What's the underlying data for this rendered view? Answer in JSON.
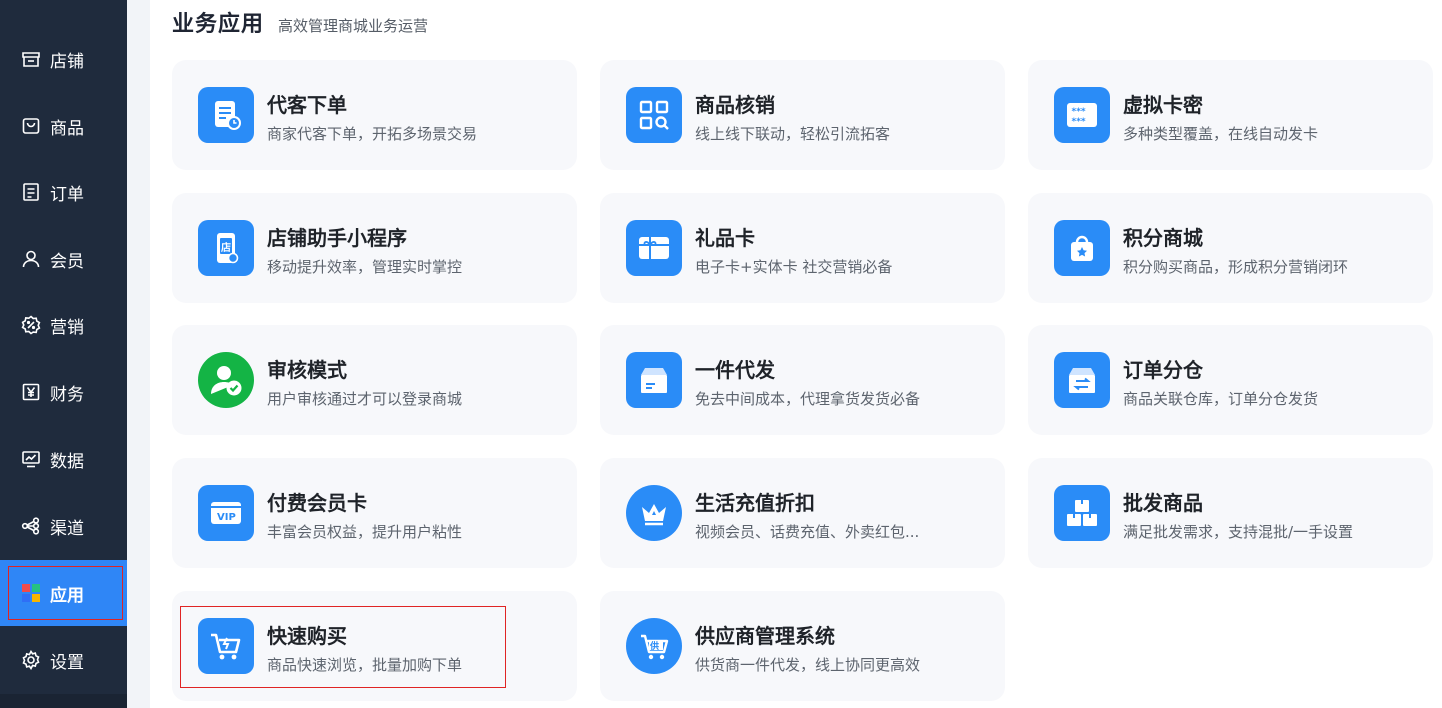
{
  "sidebar": {
    "items": [
      {
        "label": "店铺",
        "icon": "store-icon"
      },
      {
        "label": "商品",
        "icon": "bag-icon"
      },
      {
        "label": "订单",
        "icon": "order-icon"
      },
      {
        "label": "会员",
        "icon": "user-icon"
      },
      {
        "label": "营销",
        "icon": "discount-icon"
      },
      {
        "label": "财务",
        "icon": "yen-icon"
      },
      {
        "label": "数据",
        "icon": "chart-monitor-icon"
      },
      {
        "label": "渠道",
        "icon": "share-icon"
      },
      {
        "label": "应用",
        "icon": "apps-grid-icon",
        "active": true
      },
      {
        "label": "设置",
        "icon": "gear-icon"
      }
    ]
  },
  "section": {
    "title": "业务应用",
    "subtitle": "高效管理商城业务运营"
  },
  "apps": [
    {
      "name": "代客下单",
      "desc": "商家代客下单，开拓多场景交易",
      "icon": "proxy-order-icon"
    },
    {
      "name": "商品核销",
      "desc": "线上线下联动，轻松引流拓客",
      "icon": "qr-verify-icon"
    },
    {
      "name": "虚拟卡密",
      "desc": "多种类型覆盖，在线自动发卡",
      "icon": "password-card-icon"
    },
    {
      "name": "店铺助手小程序",
      "desc": "移动提升效率，管理实时掌控",
      "icon": "phone-store-icon"
    },
    {
      "name": "礼品卡",
      "desc": "电子卡+实体卡 社交营销必备",
      "icon": "gift-card-icon"
    },
    {
      "name": "积分商城",
      "desc": "积分购买商品，形成积分营销闭环",
      "icon": "points-bag-icon"
    },
    {
      "name": "审核模式",
      "desc": "用户审核通过才可以登录商城",
      "icon": "user-check-icon"
    },
    {
      "name": "一件代发",
      "desc": "免去中间成本，代理拿货发货必备",
      "icon": "box-ship-icon"
    },
    {
      "name": "订单分仓",
      "desc": "商品关联仓库，订单分仓发货",
      "icon": "warehouse-icon"
    },
    {
      "name": "付费会员卡",
      "desc": "丰富会员权益，提升用户粘性",
      "icon": "vip-card-icon"
    },
    {
      "name": "生活充值折扣",
      "desc": "视频会员、话费充值、外卖红包...",
      "icon": "crown-icon"
    },
    {
      "name": "批发商品",
      "desc": "满足批发需求，支持混批/一手设置",
      "icon": "boxes-icon"
    },
    {
      "name": "快速购买",
      "desc": "商品快速浏览，批量加购下单",
      "icon": "quick-cart-icon"
    },
    {
      "name": "供应商管理系统",
      "desc": "供货商一件代发，线上协同更高效",
      "icon": "supplier-cart-icon"
    }
  ],
  "colors": {
    "sidebar_bg": "#1f2b3d",
    "active_bg": "#2f86f6",
    "icon_blue": "#2a8cf7",
    "icon_green": "#14b445",
    "card_bg": "#f7f8fb",
    "highlight_red": "#e02424"
  }
}
